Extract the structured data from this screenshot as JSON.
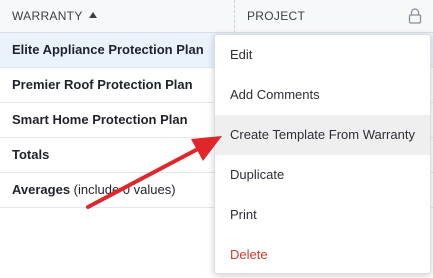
{
  "header": {
    "col_warranty": "WARRANTY",
    "col_project": "PROJECT",
    "sort_icon": "sort-ascending-icon",
    "lock_icon": "lock-icon"
  },
  "rows": [
    {
      "label": "Elite Appliance Protection Plan",
      "selected": true
    },
    {
      "label": "Premier Roof Protection Plan"
    },
    {
      "label": "Smart Home Protection Plan"
    },
    {
      "label": "Totals"
    }
  ],
  "averages": {
    "label_bold": "Averages",
    "label_normal": " (include 0 values)"
  },
  "context_menu": {
    "items": [
      {
        "label": "Edit"
      },
      {
        "label": "Add Comments"
      },
      {
        "label": "Create Template From Warranty",
        "highlighted": true
      },
      {
        "label": "Duplicate"
      },
      {
        "label": "Print"
      },
      {
        "label": "Delete",
        "danger": true
      }
    ]
  },
  "annotation": {
    "arrow_color": "#e0262a",
    "icon": "annotation-arrow"
  },
  "colors": {
    "header_bg": "#f7f8fa",
    "selected_row_bg": "#eaf2fb",
    "hover_bg": "#efefef",
    "danger": "#d23a2f"
  }
}
